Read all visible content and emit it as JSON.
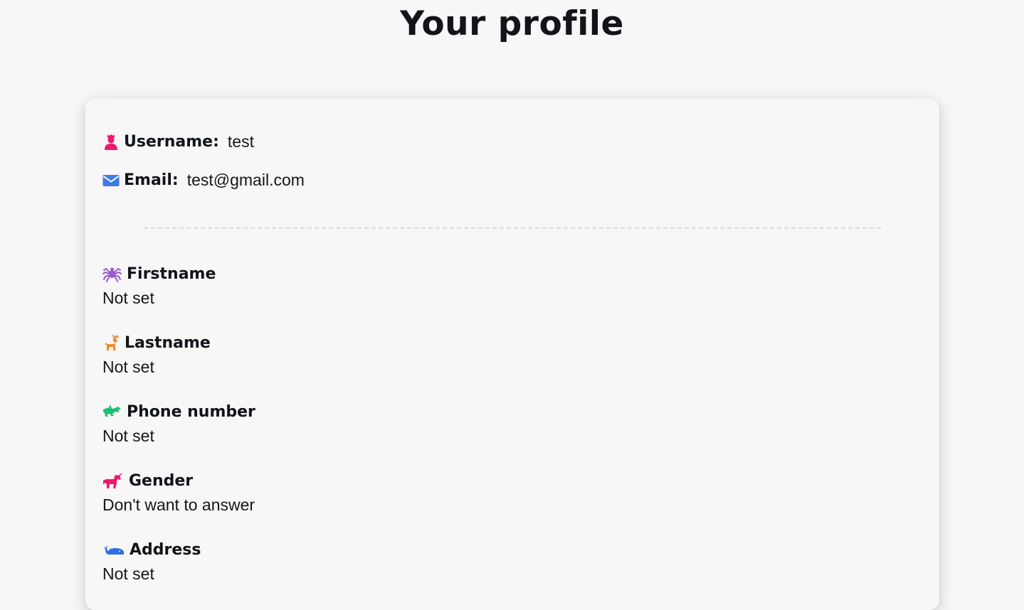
{
  "page": {
    "title": "Your profile"
  },
  "account": {
    "username_label": "Username:",
    "username_value": "test",
    "email_label": "Email:",
    "email_value": "test@gmail.com"
  },
  "fields": [
    {
      "label": "Firstname",
      "value": "Not set",
      "icon": "spider-icon",
      "color": "#9b59d0"
    },
    {
      "label": "Lastname",
      "value": "Not set",
      "icon": "deer-icon",
      "color": "#f08a24"
    },
    {
      "label": "Phone number",
      "value": "Not set",
      "icon": "dragon-icon",
      "color": "#1fbf73"
    },
    {
      "label": "Gender",
      "value": "Don't want to answer",
      "icon": "unicorn-icon",
      "color": "#f0176f"
    },
    {
      "label": "Address",
      "value": "Not set",
      "icon": "whale-icon",
      "color": "#2f6fe0"
    }
  ],
  "colors": {
    "username_icon": "#f0176f",
    "email_icon": "#3d7be8",
    "background": "#f7f7f8",
    "divider": "#d4dbe4"
  }
}
